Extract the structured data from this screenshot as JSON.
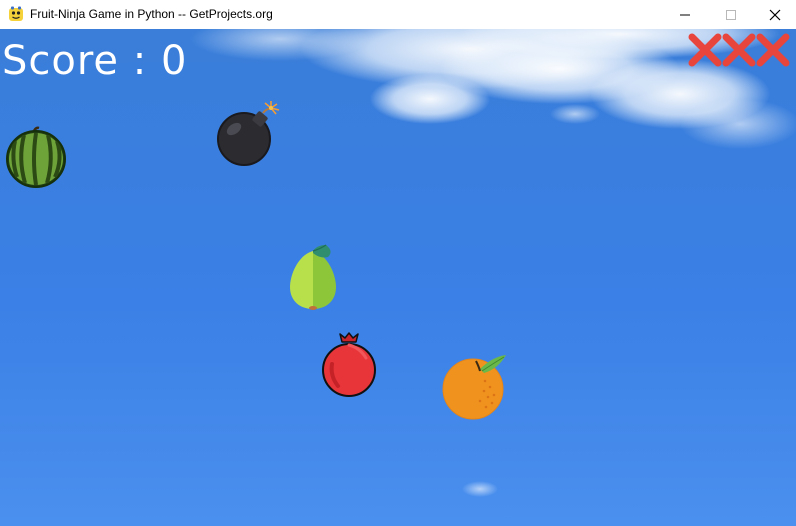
{
  "window": {
    "title": "Fruit-Ninja Game in Python -- GetProjects.org",
    "controls": [
      "minimize",
      "maximize",
      "close"
    ]
  },
  "game": {
    "score_text": "Score : 0",
    "score_value": 0,
    "lives_lost": 3,
    "lives_total": 3,
    "objects": [
      {
        "kind": "watermelon"
      },
      {
        "kind": "bomb"
      },
      {
        "kind": "guava"
      },
      {
        "kind": "pomegranate"
      },
      {
        "kind": "orange"
      }
    ]
  },
  "colors": {
    "sky": "#3c82e4",
    "score_text": "#ffffff",
    "life_mark": "#e8453c"
  },
  "icons": {
    "app": "pygame-snake-icon",
    "minimize": "minimize-icon",
    "maximize": "maximize-icon",
    "close": "close-icon",
    "lost_life": "red-x-icon"
  }
}
